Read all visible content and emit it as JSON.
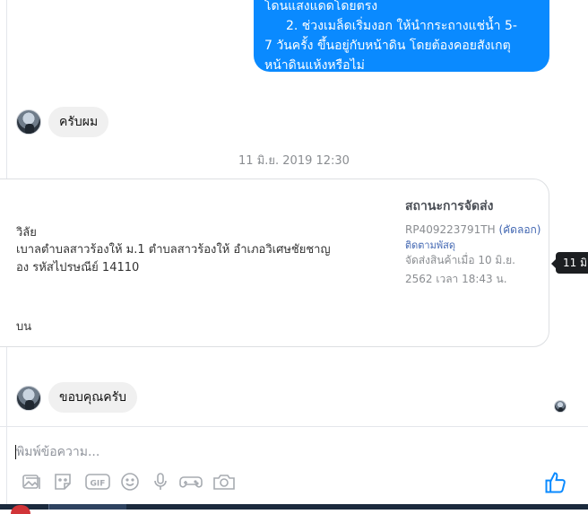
{
  "messages": {
    "outgoing": {
      "line1": "โดนแสงแดดโดยตรง",
      "line2": "2. ช่วงเมล็ดเริ่มงอก  ให้นำกระถางแช่น้ำ 5-",
      "line3": "7 วันครั้ง ขึ้นอยู่กับหน้าดิน โดยต้องคอยสังเกตุ",
      "line4": "หน้าดินแห้งหรือไม่"
    },
    "reply1": "ครับผม",
    "timestamp": "11 มิ.ย. 2019 12:30",
    "reply2": "ขอบคุณครับ"
  },
  "shipping_card": {
    "address_lines": [
      "วิลัย",
      "เบาลตำบลสาวร้องให้ ม.1  ตำบลสาวร้องให้  อำเภอวิเศษชัยชาญ",
      "อง  รหัสไปรษณีย์ 14110",
      "",
      "บน"
    ],
    "status_title": "สถานะการจัดส่ง",
    "tracking_number": "RP409223791TH",
    "copy_label": "(คัดลอก)",
    "track_link": "ติดตามพัสดุ",
    "ship_date": "จัดส่งสินค้าเมื่อ 10 มิ.ย. 2562 เวลา 18:43 น."
  },
  "tooltip": "11 มิ",
  "composer": {
    "placeholder": "พิมพ์ข้อความ..."
  },
  "icons": [
    "photo-icon",
    "sticker-icon",
    "gif-icon",
    "emoji-icon",
    "microphone-icon",
    "game-controller-icon",
    "camera-icon",
    "like-icon"
  ],
  "colors": {
    "outgoing_bubble": "#0a8aff",
    "incoming_bubble": "#f0f0f0",
    "link": "#4267b2",
    "icon_gray": "#a7abb1",
    "like_blue": "#0a8aff"
  }
}
